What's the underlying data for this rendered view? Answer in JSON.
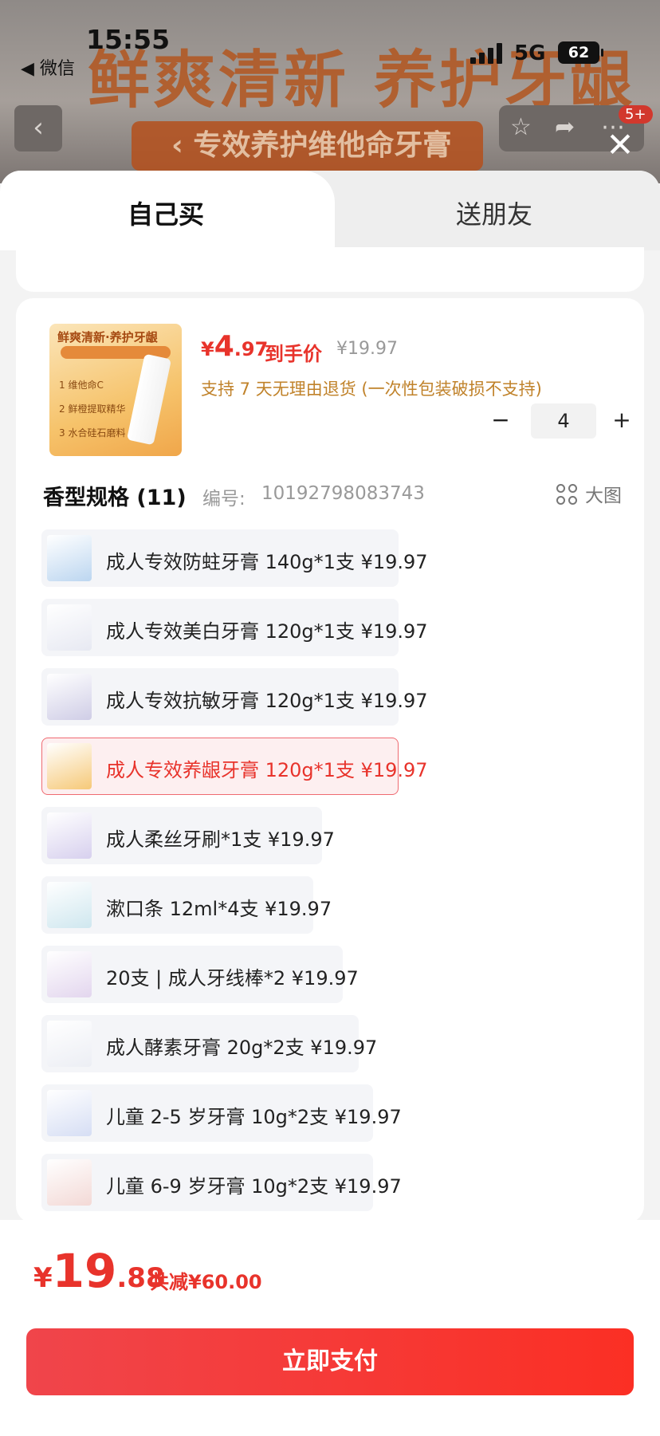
{
  "status_bar": {
    "time": "15:55",
    "back_app": "◀ 微信",
    "network": "5G",
    "battery": "62"
  },
  "background": {
    "banner_title": "鲜爽清新 养护牙龈",
    "banner_subtitle": "专效养护维他命牙膏",
    "cart_badge": "5+"
  },
  "tabs": {
    "self": "自己买",
    "gift": "送朋友"
  },
  "product": {
    "thumb": {
      "title": "鲜爽清新·养护牙龈",
      "line1": "1 维他命C",
      "line2": "2 鲜橙提取精华",
      "line3": "3 水合硅石磨料"
    },
    "price_currency": "¥",
    "price_int": "4",
    "price_dec": ".97",
    "price_tag": "到手价",
    "original_price": "¥19.97",
    "return_policy": "支持 7 天无理由退货 (一次性包装破损不支持)",
    "quantity": "4",
    "minus": "−",
    "plus": "+"
  },
  "spec": {
    "title": "香型规格 (11)",
    "code_label": "编号:",
    "code": "10192798083743",
    "big_view": "大图"
  },
  "sku_items": [
    {
      "label": "成人专效防蛀牙膏 140g*1支  ¥19.97",
      "color": "#bcd6f0",
      "selected": false
    },
    {
      "label": "成人专效美白牙膏 120g*1支  ¥19.97",
      "color": "#e7e9f2",
      "selected": false
    },
    {
      "label": "成人专效抗敏牙膏 120g*1支  ¥19.97",
      "color": "#cfcde6",
      "selected": false
    },
    {
      "label": "成人专效养龈牙膏 120g*1支  ¥19.97",
      "color": "#f6c978",
      "selected": true
    },
    {
      "label": "成人柔丝牙刷*1支  ¥19.97",
      "color": "#d7d0ee",
      "selected": false
    },
    {
      "label": "漱口条 12ml*4支  ¥19.97",
      "color": "#cfe7ef",
      "selected": false
    },
    {
      "label": "20支 | 成人牙线棒*2  ¥19.97",
      "color": "#e3d6ee",
      "selected": false
    },
    {
      "label": "成人酵素牙膏 20g*2支  ¥19.97",
      "color": "#eceef4",
      "selected": false
    },
    {
      "label": "儿童 2-5 岁牙膏 10g*2支  ¥19.97",
      "color": "#d6def4",
      "selected": false
    },
    {
      "label": "儿童 6-9 岁牙膏 10g*2支  ¥19.97",
      "color": "#f3d9d6",
      "selected": false
    }
  ],
  "footer": {
    "currency": "¥",
    "total_int": "19",
    "total_dec": ".88",
    "discount": "共减¥60.00",
    "pay_button": "立即支付"
  },
  "colors": {
    "accent": "#e8332b",
    "policy": "#c0822a",
    "selected_bg": "#fdeff0"
  }
}
